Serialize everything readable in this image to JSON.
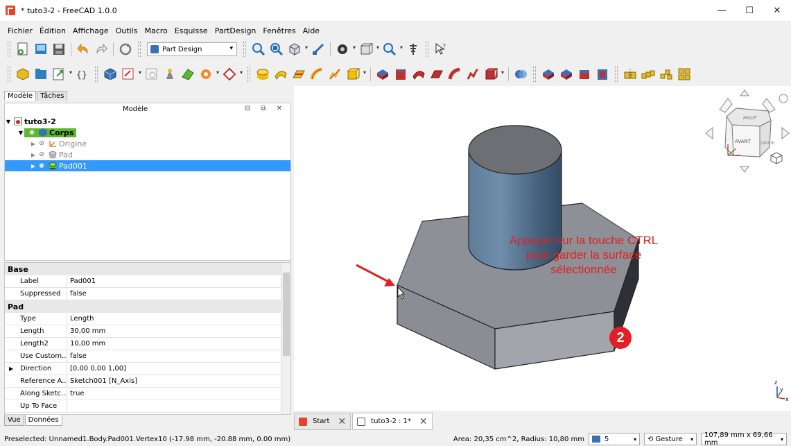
{
  "window": {
    "title": "* tuto3-2 - FreeCAD 1.0.0",
    "minimize_glyph": "—",
    "maximize_glyph": "☐",
    "close_glyph": "✕"
  },
  "menu": [
    "Fichier",
    "Édition",
    "Affichage",
    "Outils",
    "Macro",
    "Esquisse",
    "PartDesign",
    "Fenêtres",
    "Aide"
  ],
  "workbench": {
    "selected": "Part Design"
  },
  "left_tabs": [
    "Modèle",
    "Tâches"
  ],
  "tree": {
    "header": "Modèle",
    "header_buttons": "⊟ ⧉ ✕",
    "document": "tuto3-2",
    "body": "Corps",
    "items": [
      {
        "label": "Origine"
      },
      {
        "label": "Pad"
      },
      {
        "label": "Pad001"
      }
    ]
  },
  "properties": {
    "groups": [
      {
        "name": "Base",
        "rows": [
          {
            "key": "Label",
            "value": "Pad001"
          },
          {
            "key": "Suppressed",
            "value": "false"
          }
        ]
      },
      {
        "name": "Pad",
        "rows": [
          {
            "key": "Type",
            "value": "Length"
          },
          {
            "key": "Length",
            "value": "30,00 mm"
          },
          {
            "key": "Length2",
            "value": "10,00 mm"
          },
          {
            "key": "Use Custom...",
            "value": "false"
          },
          {
            "key": "Direction",
            "value": "[0,00 0,00 1,00]"
          },
          {
            "key": "Reference A...",
            "value": "Sketch001 [N_Axis]"
          },
          {
            "key": "Along Sketc...",
            "value": "true"
          },
          {
            "key": "Up To Face",
            "value": ""
          }
        ]
      }
    ]
  },
  "bottom_tabs": [
    "Vue",
    "Données"
  ],
  "annotation": {
    "lines": [
      "Appuyer sur la touche CTRL",
      "pour garder la surface",
      "sélectionnée"
    ],
    "step": "2"
  },
  "navcube": {
    "top": "HAUT",
    "front": "AVANT",
    "right": "DROITE"
  },
  "axis_labels": {
    "z": "z",
    "y": "y",
    "x": "x"
  },
  "doc_tabs": [
    {
      "label": "Start"
    },
    {
      "label": "tuto3-2 : 1*"
    }
  ],
  "status": {
    "message": "Preselected: Unnamed1.Body.Pad001.Vertex10 (-17.98 mm, -20.88 mm, 0.00 mm)",
    "area": "Area: 20,35 cm^2, Radius: 10,80 mm",
    "draw_style": "5",
    "nav_style": "Gesture",
    "dimensions": "107,89 mm x 69,66 mm"
  },
  "colors": {
    "accent": "#3399ff",
    "body_highlight": "#5cb82e",
    "annotation": "#e02020",
    "badge": "#e31e24",
    "cylinder": "#4e6d8c",
    "hexagon": "#8d8f96"
  }
}
